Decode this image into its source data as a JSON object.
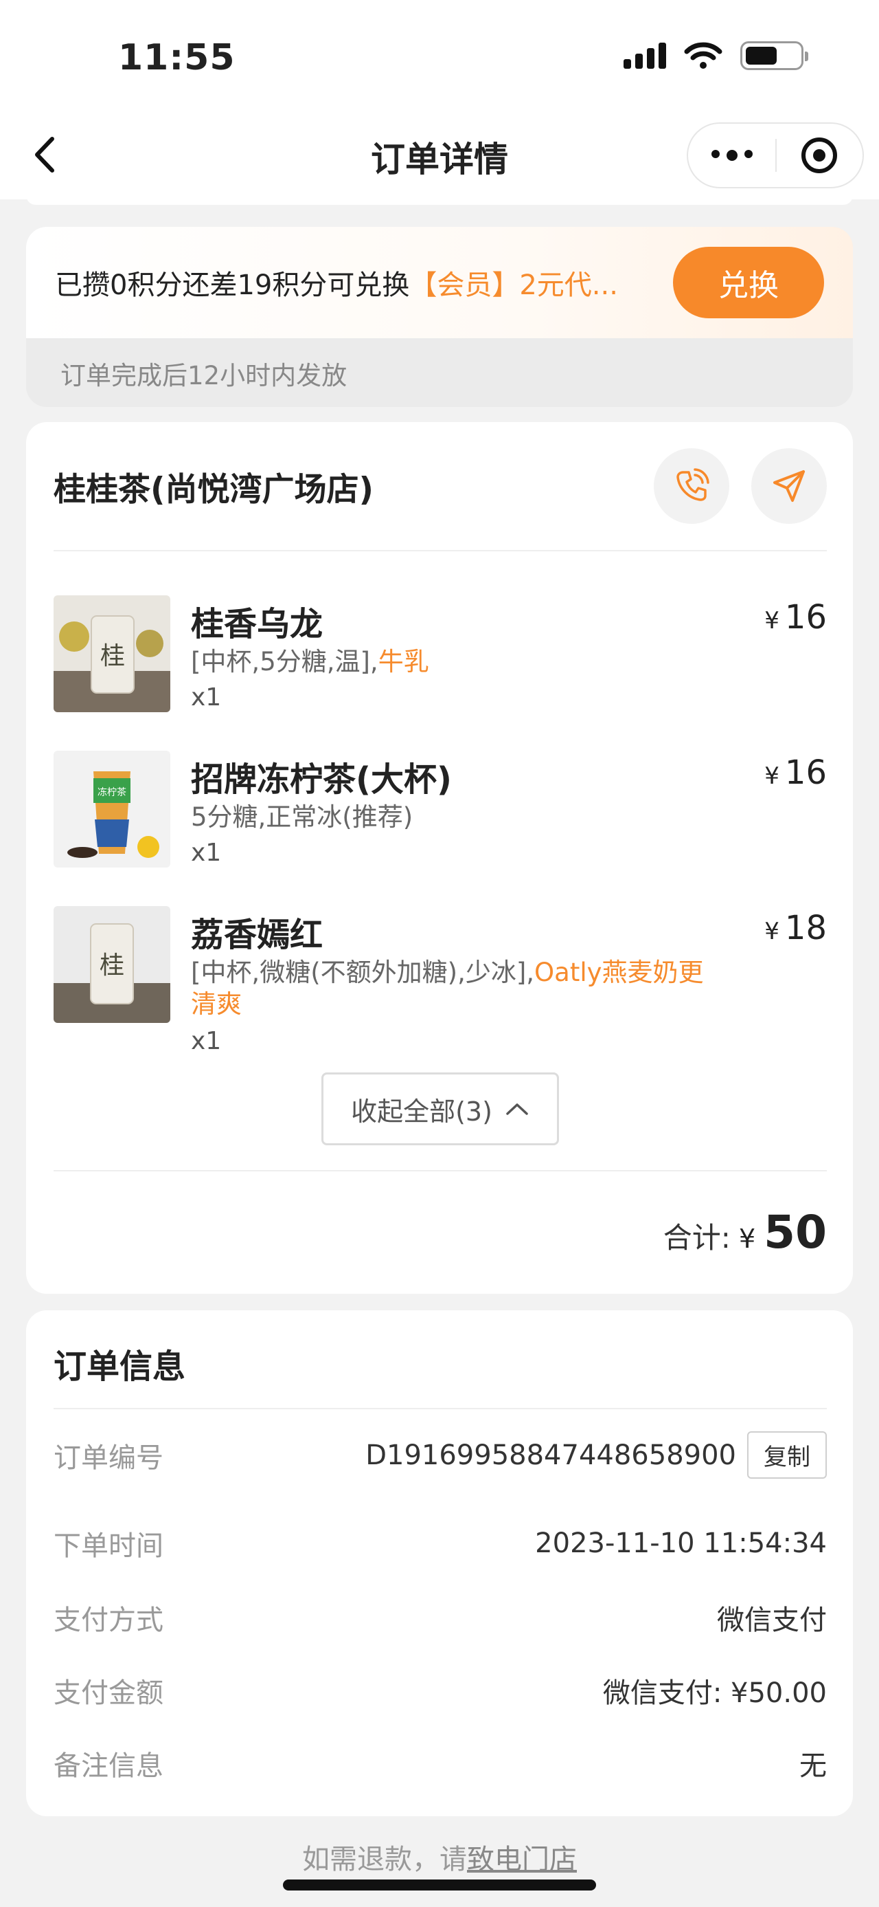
{
  "status_bar": {
    "time": "11:55"
  },
  "nav": {
    "title": "订单详情"
  },
  "points": {
    "text_prefix": "已攒0积分还差19积分可兑换",
    "text_highlight": "【会员】2元代...",
    "redeem_label": "兑换",
    "note": "订单完成后12小时内发放"
  },
  "store": {
    "name": "桂桂茶(尚悦湾广场店)",
    "items": [
      {
        "name": "桂香乌龙",
        "options": "[中杯,5分糖,温],",
        "options_highlight": "牛乳",
        "qty": "x1",
        "currency": "¥",
        "price": "16"
      },
      {
        "name": "招牌冻柠茶(大杯)",
        "options": "5分糖,正常冰(推荐)",
        "options_highlight": "",
        "qty": "x1",
        "currency": "¥",
        "price": "16"
      },
      {
        "name": "荔香嫣红",
        "options": "[中杯,微糖(不额外加糖),少冰],",
        "options_highlight": "Oatly燕麦奶更清爽",
        "qty": "x1",
        "currency": "¥",
        "price": "18"
      }
    ],
    "collapse_label": "收起全部(3)",
    "total_label": "合计:",
    "total_currency": "¥",
    "total_value": "50"
  },
  "order_info": {
    "title": "订单信息",
    "rows": [
      {
        "label": "订单编号",
        "value": "D191699588474486589​00"
      },
      {
        "label": "下单时间",
        "value": "2023-11-10 11:54:34"
      },
      {
        "label": "支付方式",
        "value": "微信支付"
      },
      {
        "label": "支付金额",
        "value": "微信支付: ¥50.00"
      },
      {
        "label": "备注信息",
        "value": "无"
      }
    ],
    "copy_label": "复制"
  },
  "footer": {
    "text": "如需退款，请",
    "link": "致电门店"
  },
  "colors": {
    "accent": "#f7892a",
    "highlight_text": "#f68b2d",
    "background": "#f2f2f2"
  }
}
